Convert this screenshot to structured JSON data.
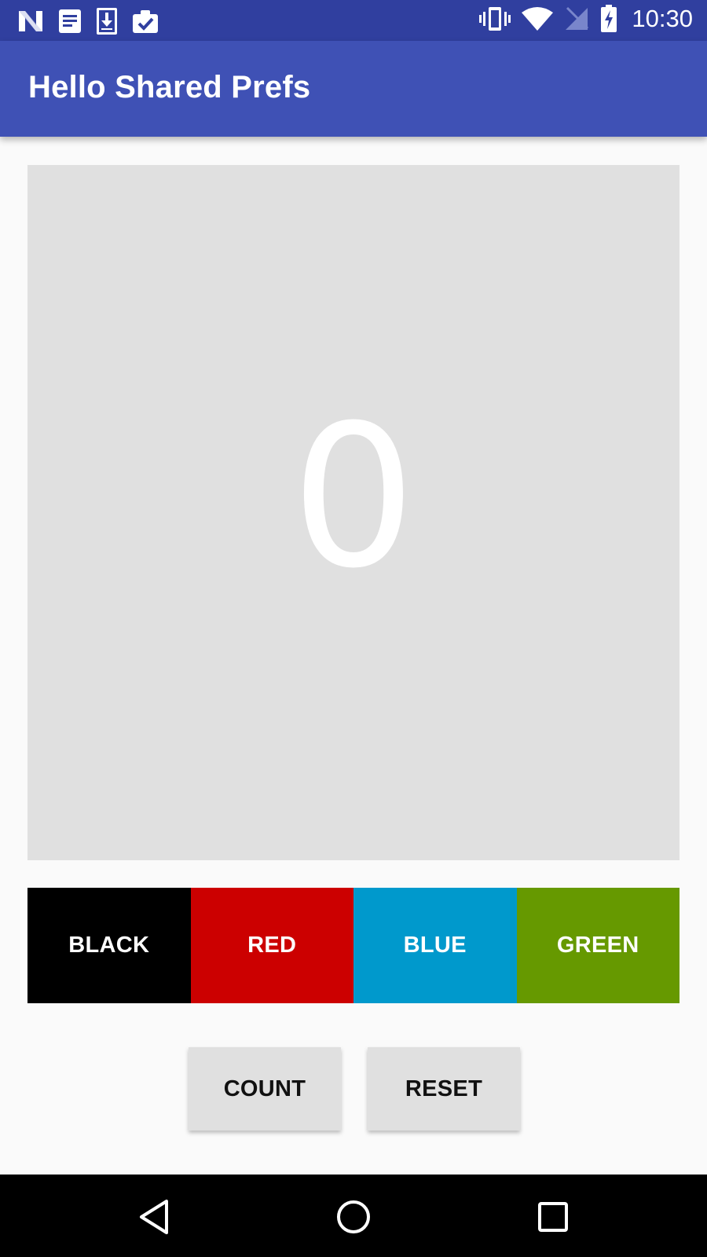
{
  "status_bar": {
    "time": "10:30",
    "left_icons": [
      "n-logo-icon",
      "notes-icon",
      "download-icon",
      "clipboard-check-icon"
    ],
    "right_icons": [
      "vibrate-icon",
      "wifi-icon",
      "no-signal-icon",
      "battery-charging-icon"
    ]
  },
  "app_bar": {
    "title": "Hello Shared Prefs"
  },
  "counter": {
    "value": "0",
    "background": "#e0e0e0",
    "text_color": "#ffffff"
  },
  "color_buttons": [
    {
      "label": "BLACK",
      "color": "#000000"
    },
    {
      "label": "RED",
      "color": "#cc0000"
    },
    {
      "label": "BLUE",
      "color": "#0099cc"
    },
    {
      "label": "GREEN",
      "color": "#669900"
    }
  ],
  "actions": {
    "count_label": "COUNT",
    "reset_label": "RESET"
  },
  "nav_bar": {
    "icons": [
      "back-icon",
      "home-icon",
      "recents-icon"
    ]
  },
  "colors": {
    "status_bar": "#303f9f",
    "app_bar": "#3f51b5",
    "nav_bar": "#000000"
  }
}
